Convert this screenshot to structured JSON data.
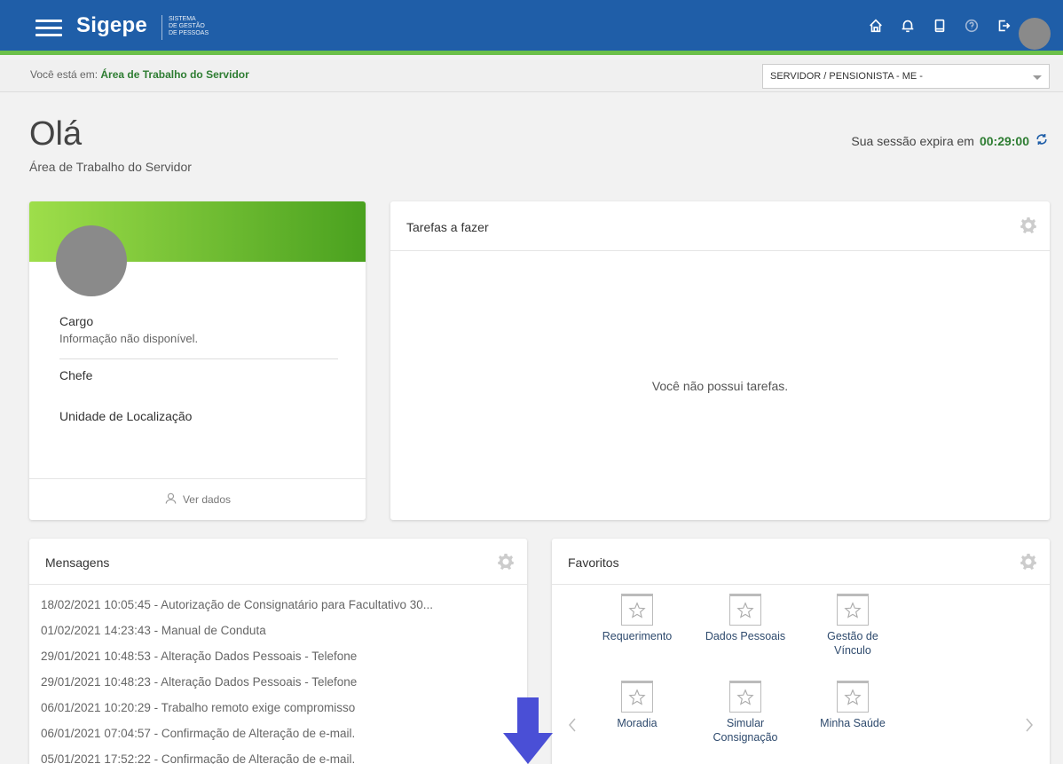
{
  "header": {
    "brand": "Sigepe",
    "brand_sub_1": "SISTEMA",
    "brand_sub_2": "DE GESTÃO",
    "brand_sub_3": "DE PESSOAS",
    "icons": [
      "home-icon",
      "bell-icon",
      "tablet-icon",
      "help-icon",
      "logout-icon"
    ]
  },
  "breadcrumb": {
    "prefix": "Você está em:",
    "current": "Área de Trabalho do Servidor"
  },
  "profile_select": {
    "value": "SERVIDOR / PENSIONISTA - ME -"
  },
  "page": {
    "title": "Olá",
    "subtitle": "Área de Trabalho do Servidor"
  },
  "session": {
    "label": "Sua sessão expira em",
    "time": "00:29:00"
  },
  "profile_card": {
    "cargo_label": "Cargo",
    "cargo_value": "Informação não disponível.",
    "chefe_label": "Chefe",
    "unidade_label": "Unidade de Localização",
    "footer_link": "Ver dados"
  },
  "tasks": {
    "title": "Tarefas a fazer",
    "empty": "Você não possui tarefas."
  },
  "messages": {
    "title": "Mensagens",
    "items": [
      "18/02/2021 10:05:45 - Autorização de Consignatário para Facultativo 30...",
      "01/02/2021 14:23:43 - Manual de Conduta",
      "29/01/2021 10:48:53 - Alteração Dados Pessoais - Telefone",
      "29/01/2021 10:48:23 - Alteração Dados Pessoais - Telefone",
      "06/01/2021 10:20:29 - Trabalho remoto exige compromisso",
      "06/01/2021 07:04:57 - Confirmação de Alteração de e-mail.",
      "05/01/2021 17:52:22 - Confirmação de Alteração de e-mail."
    ]
  },
  "favorites": {
    "title": "Favoritos",
    "items": [
      {
        "label": "Requerimento"
      },
      {
        "label": "Dados Pessoais"
      },
      {
        "label": "Gestão de Vínculo"
      },
      {
        "label": "Moradia"
      },
      {
        "label": "Simular Consignação"
      },
      {
        "label": "Minha Saúde"
      }
    ]
  },
  "colors": {
    "header_blue": "#1f5ea8",
    "accent_green": "#6cc04a",
    "session_green": "#2e7d32",
    "scroll_arrow": "#4a4fd6"
  }
}
